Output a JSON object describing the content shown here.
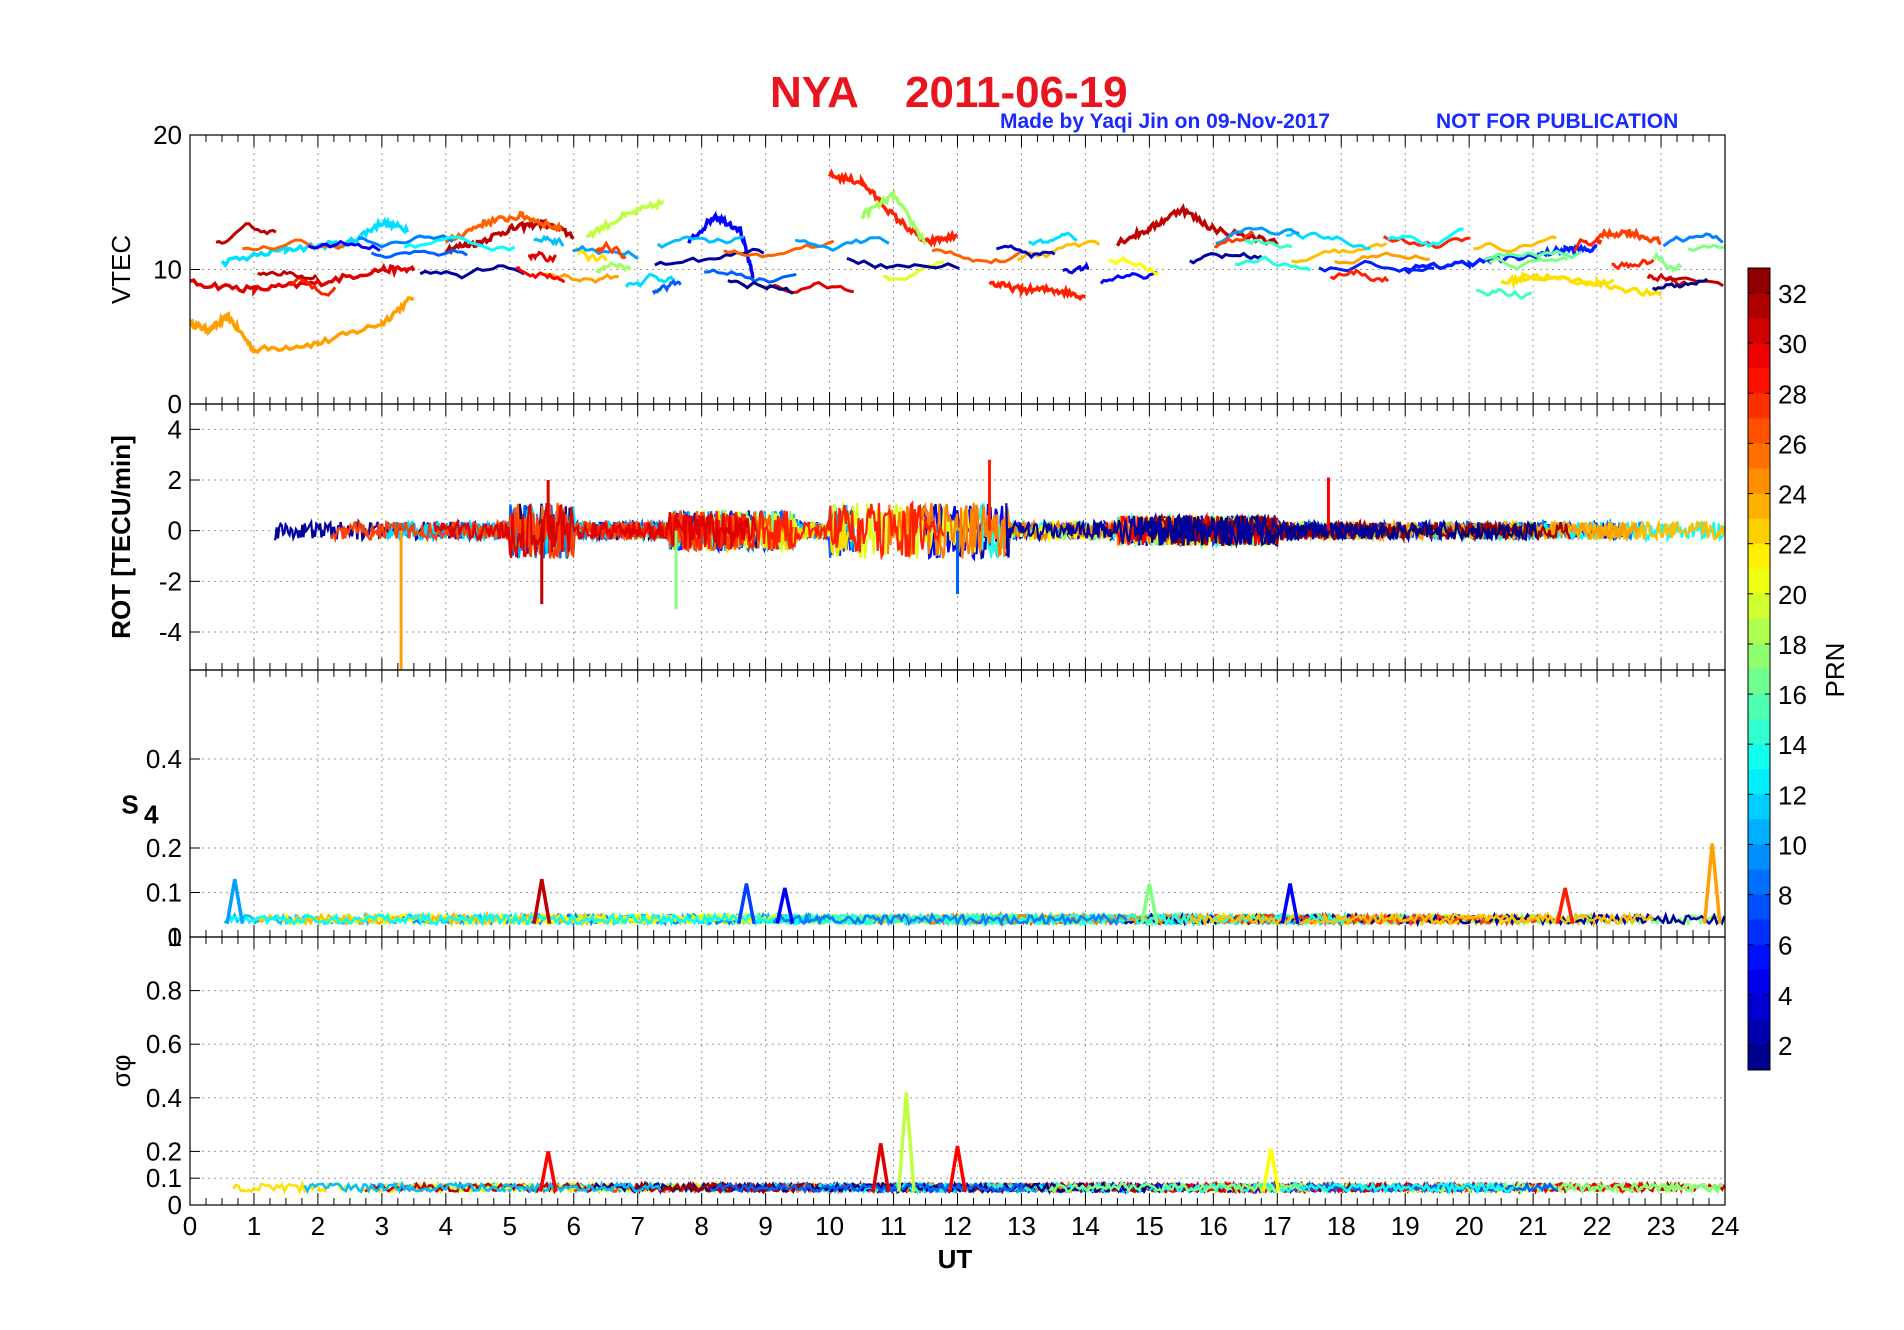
{
  "chart_data": {
    "title_station": "NYA",
    "title_date": "2011-06-19",
    "credit": "Made by Yaqi Jin on 09-Nov-2017",
    "notice": "NOT FOR PUBLICATION",
    "x_label": "UT",
    "x_range": [
      0,
      24
    ],
    "x_ticks": [
      "0",
      "1",
      "2",
      "3",
      "4",
      "5",
      "6",
      "7",
      "8",
      "9",
      "10",
      "11",
      "12",
      "13",
      "14",
      "15",
      "16",
      "17",
      "18",
      "19",
      "20",
      "21",
      "22",
      "23",
      "24"
    ],
    "colorbar": {
      "label": "PRN",
      "range": [
        1,
        33
      ],
      "ticks": [
        "2",
        "4",
        "6",
        "8",
        "10",
        "12",
        "14",
        "16",
        "18",
        "20",
        "22",
        "24",
        "26",
        "28",
        "30",
        "32"
      ],
      "colormap": "jet"
    },
    "panels": [
      {
        "type": "line",
        "ylabel": "VTEC",
        "ylim": [
          0,
          20
        ],
        "yticks": [
          "0",
          "10",
          "20"
        ],
        "grid": true,
        "series_approx": [
          {
            "prn": 24,
            "x": [
              0,
              0.3,
              0.6,
              1,
              2,
              3,
              3.5
            ],
            "y": [
              6,
              5.5,
              6.5,
              4,
              4.5,
              6,
              8
            ]
          },
          {
            "prn": 30,
            "x": [
              0,
              1,
              2,
              3,
              3.5
            ],
            "y": [
              9,
              8.5,
              9,
              10,
              10
            ]
          },
          {
            "prn": 12,
            "x": [
              0.5,
              1.5,
              2.5,
              3,
              3.4
            ],
            "y": [
              10.5,
              11.5,
              12,
              13.5,
              13
            ]
          },
          {
            "prn": 31,
            "x": [
              4,
              4.5,
              5,
              5.5,
              6
            ],
            "y": [
              11.5,
              12,
              13,
              13.5,
              12.5
            ]
          },
          {
            "prn": 26,
            "x": [
              4,
              4.6,
              5.2,
              5.8
            ],
            "y": [
              12,
              13.5,
              14,
              13
            ]
          },
          {
            "prn": 19,
            "x": [
              6.2,
              6.8,
              7.4
            ],
            "y": [
              12.5,
              14,
              15
            ]
          },
          {
            "prn": 5,
            "x": [
              7.8,
              8.2,
              8.6,
              8.8
            ],
            "y": [
              12,
              14,
              13,
              9.5
            ]
          },
          {
            "prn": 28,
            "x": [
              10,
              10.5,
              11,
              11.5,
              12
            ],
            "y": [
              17,
              16.5,
              14,
              12,
              12.5
            ]
          },
          {
            "prn": 18,
            "x": [
              10.5,
              11,
              11.5
            ],
            "y": [
              14,
              15.5,
              12
            ]
          },
          {
            "prn": 28,
            "x": [
              12.5,
              13,
              13.5,
              14
            ],
            "y": [
              9,
              8.5,
              8.5,
              8
            ]
          },
          {
            "prn": 31,
            "x": [
              14.5,
              15,
              15.5,
              16,
              17
            ],
            "y": [
              12,
              13,
              14.5,
              13,
              12
            ]
          },
          {
            "prn": 6,
            "x": [
              19,
              20,
              21,
              21.5,
              22
            ],
            "y": [
              10,
              10.5,
              11,
              11.5,
              11.5
            ]
          },
          {
            "prn": 27,
            "x": [
              22,
              22.5,
              23
            ],
            "y": [
              12.5,
              12.8,
              12
            ]
          },
          {
            "prn": 22,
            "x": [
              20.5,
              21,
              22,
              23
            ],
            "y": [
              9,
              9.5,
              9,
              8
            ]
          }
        ]
      },
      {
        "type": "line",
        "ylabel": "ROT [TECU/min]",
        "ylim": [
          -5.5,
          5
        ],
        "yticks": [
          "-4",
          "-2",
          "0",
          "2",
          "4"
        ],
        "grid": true,
        "notable_spikes": [
          {
            "x": 3.3,
            "y": -5.5,
            "prn": 24
          },
          {
            "x": 5.5,
            "y": -2.9,
            "prn": 31
          },
          {
            "x": 5.6,
            "y": 2.0,
            "prn": 30
          },
          {
            "x": 7.6,
            "y": -3.1,
            "prn": 17
          },
          {
            "x": 12.5,
            "y": 2.8,
            "prn": 28
          },
          {
            "x": 12.0,
            "y": -2.5,
            "prn": 8
          },
          {
            "x": 17.8,
            "y": 2.1,
            "prn": 29
          }
        ]
      },
      {
        "type": "line",
        "ylabel": "S4",
        "ylim": [
          0,
          0.6
        ],
        "yticks": [
          "0",
          "0.1",
          "0.2",
          "0.4"
        ],
        "grid": true,
        "notable_peaks": [
          {
            "x": 0.7,
            "y": 0.13,
            "prn": 10
          },
          {
            "x": 5.5,
            "y": 0.13,
            "prn": 31
          },
          {
            "x": 8.7,
            "y": 0.12,
            "prn": 7
          },
          {
            "x": 9.3,
            "y": 0.11,
            "prn": 5
          },
          {
            "x": 15.0,
            "y": 0.12,
            "prn": 17
          },
          {
            "x": 17.2,
            "y": 0.12,
            "prn": 5
          },
          {
            "x": 21.5,
            "y": 0.11,
            "prn": 28
          },
          {
            "x": 23.8,
            "y": 0.21,
            "prn": 24
          }
        ]
      },
      {
        "type": "line",
        "ylabel": "σφ",
        "ylim": [
          0,
          1
        ],
        "yticks": [
          "0",
          "0.1",
          "0.2",
          "0.4",
          "0.6",
          "0.8",
          "1"
        ],
        "grid": true,
        "notable_peaks": [
          {
            "x": 5.6,
            "y": 0.2,
            "prn": 29
          },
          {
            "x": 10.8,
            "y": 0.23,
            "prn": 30
          },
          {
            "x": 11.2,
            "y": 0.42,
            "prn": 19
          },
          {
            "x": 12.0,
            "y": 0.22,
            "prn": 29
          },
          {
            "x": 16.9,
            "y": 0.21,
            "prn": 21
          }
        ]
      }
    ]
  }
}
